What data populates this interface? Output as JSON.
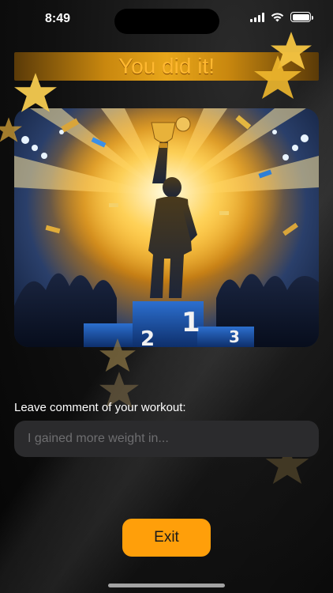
{
  "status_bar": {
    "time": "8:49",
    "icons": [
      "signal-icon",
      "wifi-icon",
      "battery-icon"
    ],
    "battery_level": 1.0
  },
  "banner": {
    "title": "You did it!"
  },
  "hero_image": {
    "podium_labels": [
      "2",
      "1",
      "3"
    ]
  },
  "comment": {
    "label": "Leave comment of your workout:",
    "placeholder": "I gained more weight in...",
    "value": ""
  },
  "exit_button": {
    "label": "Exit"
  },
  "colors": {
    "accent": "#ff9f0a",
    "banner_gold": "#e8a61a",
    "title_text": "#ffb830",
    "star": "#f5c542",
    "input_bg": "#2b2b2d",
    "background": "#0b0b0b"
  }
}
